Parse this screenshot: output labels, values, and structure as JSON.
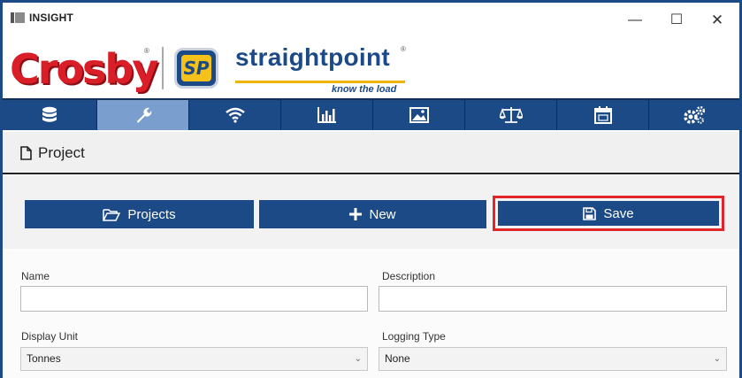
{
  "window": {
    "title": "INSIGHT",
    "controls": {
      "minimize": "—",
      "maximize": "☐",
      "close": "✕"
    }
  },
  "branding": {
    "crosby": "Crosby",
    "crosby_reg": "®",
    "sp_badge": "SP",
    "straightpoint": "straightpoint",
    "straightpoint_reg": "®",
    "tagline": "know the load"
  },
  "toolbar": {
    "items": [
      {
        "name": "database",
        "icon": "database-icon"
      },
      {
        "name": "wrench",
        "icon": "wrench-icon",
        "active": true
      },
      {
        "name": "wireless",
        "icon": "wifi-icon"
      },
      {
        "name": "chart",
        "icon": "bar-chart-icon"
      },
      {
        "name": "image",
        "icon": "image-icon"
      },
      {
        "name": "scales",
        "icon": "scales-icon"
      },
      {
        "name": "calendar",
        "icon": "calendar-icon"
      },
      {
        "name": "settings",
        "icon": "gears-icon"
      }
    ],
    "colors": {
      "bar": "#1c4a86",
      "active": "#7a9fcf"
    }
  },
  "section": {
    "title": "Project",
    "icon": "document-icon"
  },
  "actions": {
    "projects_label": "Projects",
    "new_label": "New",
    "save_label": "Save",
    "highlight_color": "#e0262a"
  },
  "form": {
    "name_label": "Name",
    "name_value": "",
    "description_label": "Description",
    "description_value": "",
    "display_unit_label": "Display Unit",
    "display_unit_value": "Tonnes",
    "logging_type_label": "Logging Type",
    "logging_type_value": "None"
  }
}
